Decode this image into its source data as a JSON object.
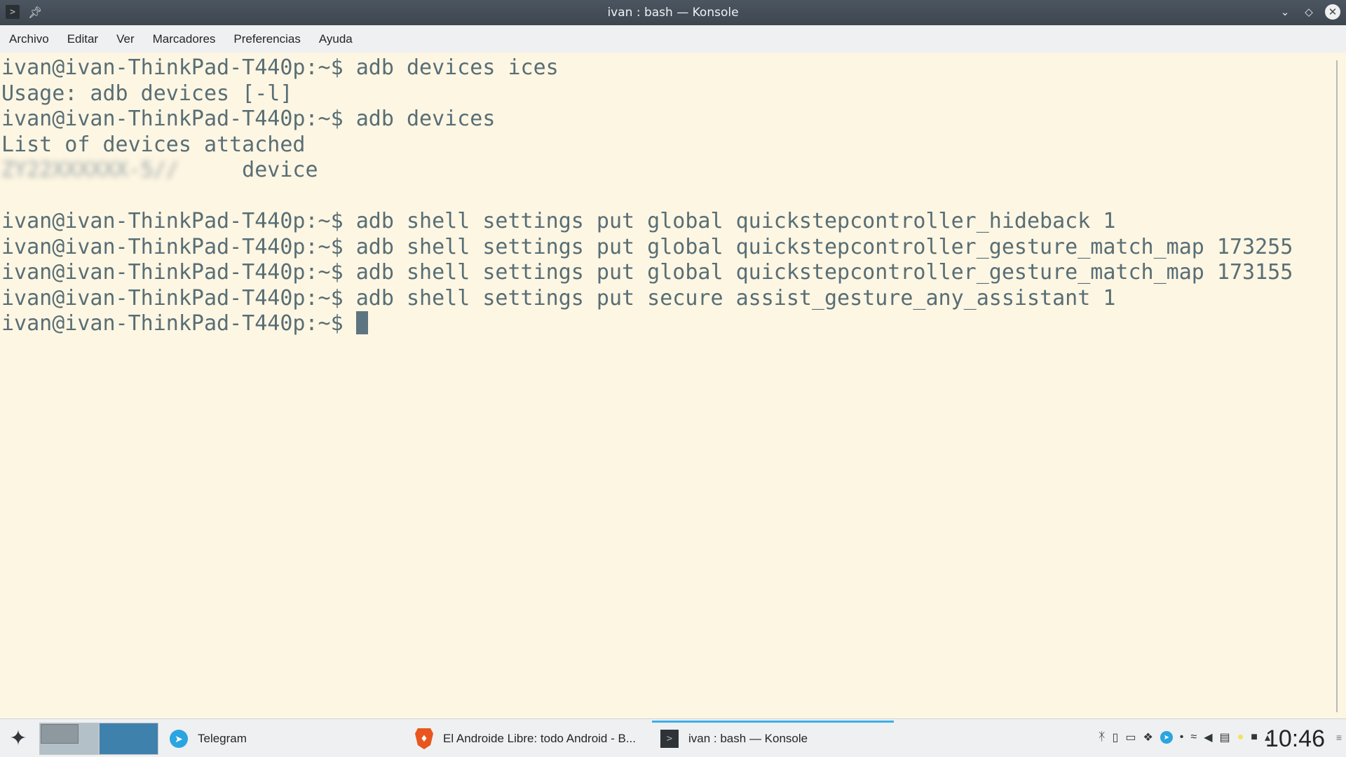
{
  "window": {
    "title": "ivan : bash — Konsole",
    "icons": {
      "app": "terminal-icon",
      "pin": "pin-icon",
      "minimize": "chevron-down-icon",
      "maximize": "diamond-icon",
      "close": "close-icon"
    }
  },
  "menu": [
    "Archivo",
    "Editar",
    "Ver",
    "Marcadores",
    "Preferencias",
    "Ayuda"
  ],
  "terminal": {
    "lines": [
      "ivan@ivan-ThinkPad-T440p:~$ adb devices ices",
      "Usage: adb devices [-l]",
      "ivan@ivan-ThinkPad-T440p:~$ adb devices",
      "List of devices attached",
      "",
      "",
      "ivan@ivan-ThinkPad-T440p:~$ adb shell settings put global quickstepcontroller_hideback 1",
      "ivan@ivan-ThinkPad-T440p:~$ adb shell settings put global quickstepcontroller_gesture_match_map 173255",
      "ivan@ivan-ThinkPad-T440p:~$ adb shell settings put global quickstepcontroller_gesture_match_map 173155",
      "ivan@ivan-ThinkPad-T440p:~$ adb shell settings put secure assist_gesture_any_assistant 1"
    ],
    "device_status": "device",
    "prompt": "ivan@ivan-ThinkPad-T440p:~$ "
  },
  "taskbar": {
    "tasks": [
      {
        "label": "Telegram",
        "icon": "telegram-icon"
      },
      {
        "label": "El Androide Libre: todo Android - B...",
        "icon": "brave-icon"
      },
      {
        "label": "ivan : bash — Konsole",
        "icon": "terminal-icon"
      }
    ],
    "tray_icons": [
      "bluetooth-icon",
      "phone-icon",
      "battery-icon",
      "dropbox-icon",
      "telegram-icon",
      "bulb-icon",
      "wifi-icon",
      "volume-icon",
      "clipboard-icon",
      "night-light-icon",
      "lock-icon",
      "expand-arrow-icon"
    ],
    "clock": "10:46",
    "colors": {
      "accent": "#3daee9",
      "terminal_bg": "#fdf6e3",
      "terminal_fg": "#586e75"
    }
  }
}
